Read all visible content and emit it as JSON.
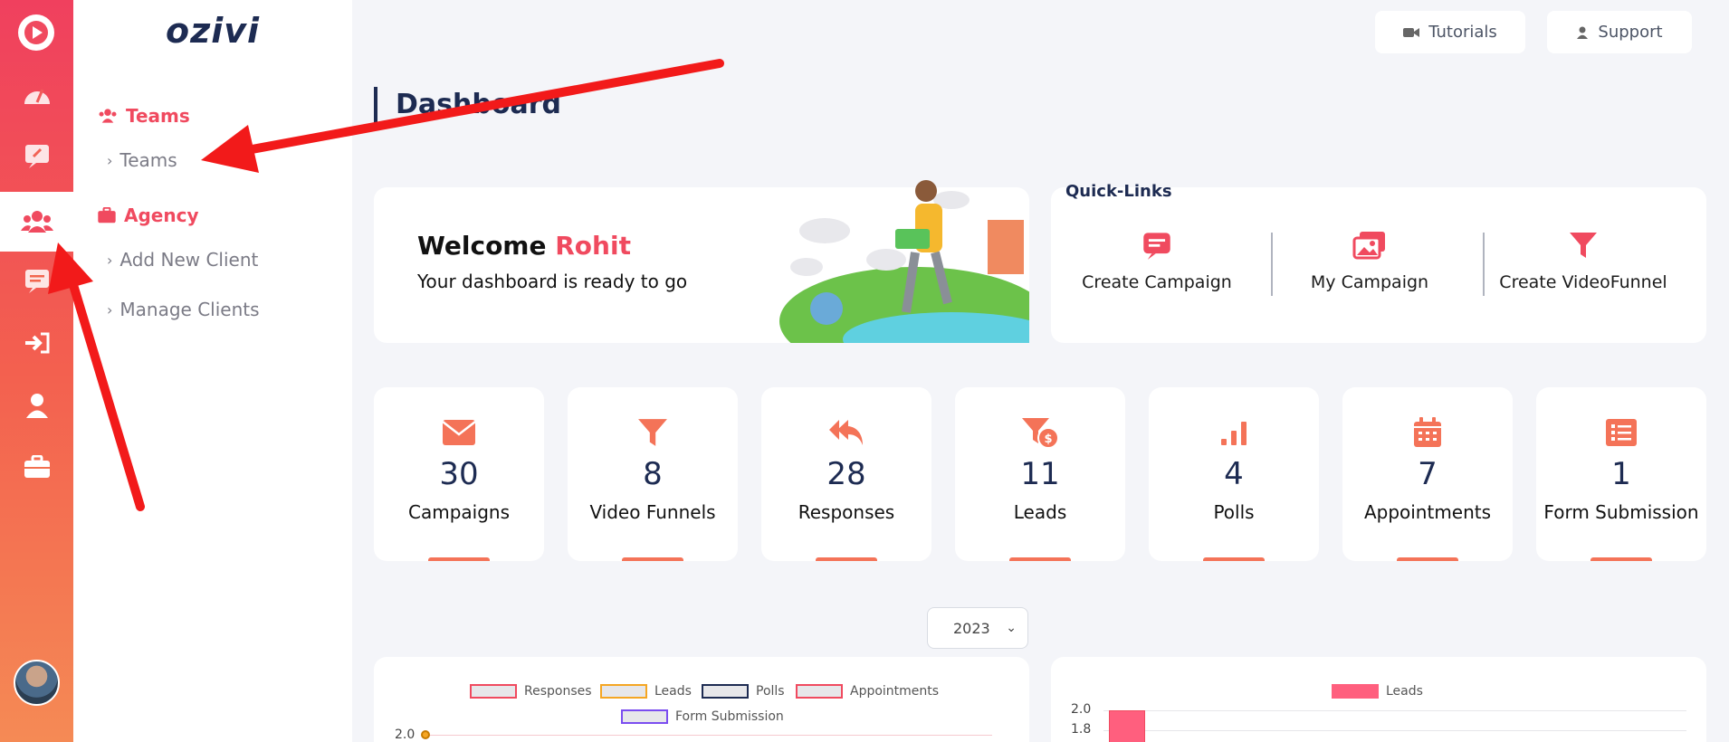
{
  "brand": "ozivi",
  "rail": {
    "items": [
      {
        "icon": "dashboard-gauge-icon"
      },
      {
        "icon": "edit-icon"
      },
      {
        "icon": "team-icon",
        "active": true
      },
      {
        "icon": "message-icon"
      },
      {
        "icon": "login-icon"
      },
      {
        "icon": "user-icon"
      },
      {
        "icon": "briefcase-icon"
      }
    ]
  },
  "subnav": {
    "teams_section": "Teams",
    "teams_item": "Teams",
    "agency_section": "Agency",
    "agency_items": [
      "Add New Client",
      "Manage Clients"
    ]
  },
  "topbar": {
    "tutorials": "Tutorials",
    "support": "Support"
  },
  "page_title": "Dashboard",
  "welcome": {
    "greeting": "Welcome",
    "name": "Rohit",
    "subtitle": "Your dashboard is ready to go"
  },
  "quick_links": {
    "title": "Quick-Links",
    "items": [
      "Create Campaign",
      "My Campaign",
      "Create VideoFunnel"
    ]
  },
  "stats": [
    {
      "value": "30",
      "label": "Campaigns",
      "icon": "envelope-icon"
    },
    {
      "value": "8",
      "label": "Video Funnels",
      "icon": "funnel-icon"
    },
    {
      "value": "28",
      "label": "Responses",
      "icon": "reply-all-icon"
    },
    {
      "value": "11",
      "label": "Leads",
      "icon": "funnel-dollar-icon"
    },
    {
      "value": "4",
      "label": "Polls",
      "icon": "signal-bars-icon"
    },
    {
      "value": "7",
      "label": "Appointments",
      "icon": "calendar-icon"
    },
    {
      "value": "1",
      "label": "Form Submission",
      "icon": "list-icon"
    }
  ],
  "year_select": "2023",
  "chart_data": [
    {
      "type": "line",
      "legend": [
        "Responses",
        "Leads",
        "Polls",
        "Appointments",
        "Form Submission"
      ],
      "legend_colors": [
        "#f04a5f",
        "#f5a623",
        "#1d2b52",
        "#f04a5f",
        "#7b4df0"
      ],
      "y_ticks": [
        "2.0"
      ]
    },
    {
      "type": "bar",
      "legend": [
        "Leads"
      ],
      "legend_colors": [
        "#ff5f7e"
      ],
      "y_ticks": [
        "2.0",
        "1.8"
      ]
    }
  ],
  "colors": {
    "accent": "#f04a5f",
    "orange": "#f47358",
    "navy": "#1d2b52"
  }
}
